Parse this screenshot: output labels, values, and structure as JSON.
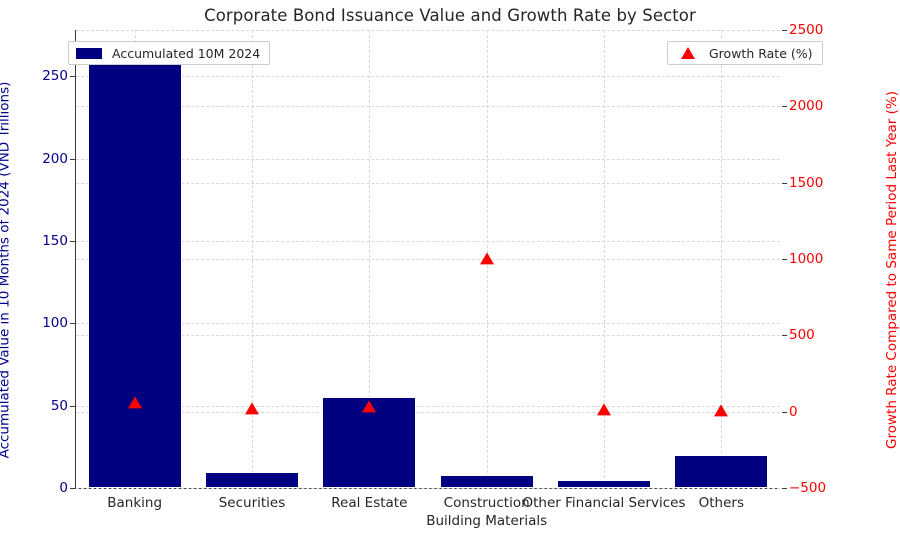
{
  "chart_data": {
    "type": "bar",
    "title": "Corporate Bond Issuance Value and Growth Rate by Sector",
    "xlabel": "",
    "categories": [
      "Banking",
      "Securities",
      "Real Estate",
      "Construction\nBuilding Materials",
      "Other Financial Services",
      "Others"
    ],
    "series": [
      {
        "name": "Accumulated 10M 2024",
        "type": "bar",
        "axis": "left",
        "color": "#000080",
        "values": [
          262,
          10,
          55,
          8,
          5,
          20
        ]
      },
      {
        "name": "Growth Rate (%)",
        "type": "scatter",
        "marker": "triangle-up",
        "axis": "right",
        "color": "#ff0000",
        "values": [
          60,
          15,
          30,
          1000,
          10,
          5
        ]
      }
    ],
    "left_axis": {
      "label": "Accumulated Value in 10 Months of 2024 (VND Trillions)",
      "color": "#00008b",
      "ylim": [
        0,
        278
      ],
      "ticks": [
        0,
        50,
        100,
        150,
        200,
        250
      ],
      "tick_labels": [
        "0",
        "50",
        "100",
        "150",
        "200",
        "250"
      ]
    },
    "right_axis": {
      "label": "Growth Rate Compared to Same Period Last Year (%)",
      "color": "#ff0000",
      "ylim": [
        -500,
        2500
      ],
      "ticks": [
        -500,
        0,
        500,
        1000,
        1500,
        2000,
        2500
      ],
      "tick_labels": [
        "−500",
        "0",
        "500",
        "1000",
        "1500",
        "2000",
        "2500"
      ]
    },
    "grid": true,
    "legend": [
      {
        "label": "Accumulated 10M 2024",
        "position": "upper left",
        "marker": "bar"
      },
      {
        "label": "Growth Rate (%)",
        "position": "upper right",
        "marker": "triangle-up"
      }
    ]
  }
}
